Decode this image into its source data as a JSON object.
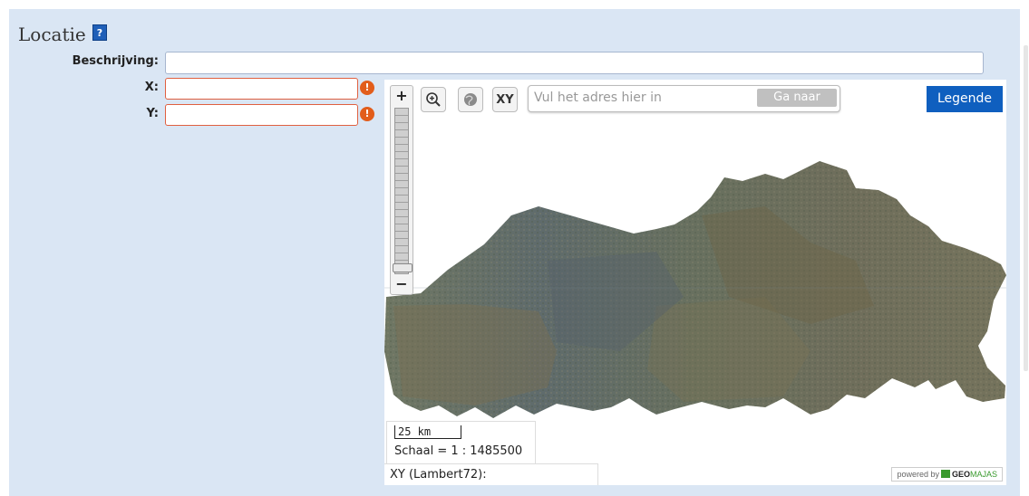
{
  "section": {
    "title": "Locatie",
    "help_icon": "?"
  },
  "form": {
    "description_label": "Beschrijving:",
    "description_value": "",
    "x_label": "X:",
    "x_value": "",
    "y_label": "Y:",
    "y_value": "",
    "error_icon": "!"
  },
  "map": {
    "zoom_in": "+",
    "zoom_out": "−",
    "xy_button": "XY",
    "search_placeholder": "Vul het adres hier in",
    "search_button": "Ga naar",
    "legend_button": "Legende",
    "scale_distance": "25 km",
    "scale_ratio": "Schaal = 1 : 1485500",
    "coords_label": "XY (Lambert72):",
    "powered_by": "powered by",
    "brand_geo": "GEO",
    "brand_majas": "MAJAS"
  },
  "colors": {
    "panel_bg": "#dae6f4",
    "legend_blue": "#0f5fbf",
    "error_orange": "#e25d1b",
    "error_border": "#e06040"
  }
}
